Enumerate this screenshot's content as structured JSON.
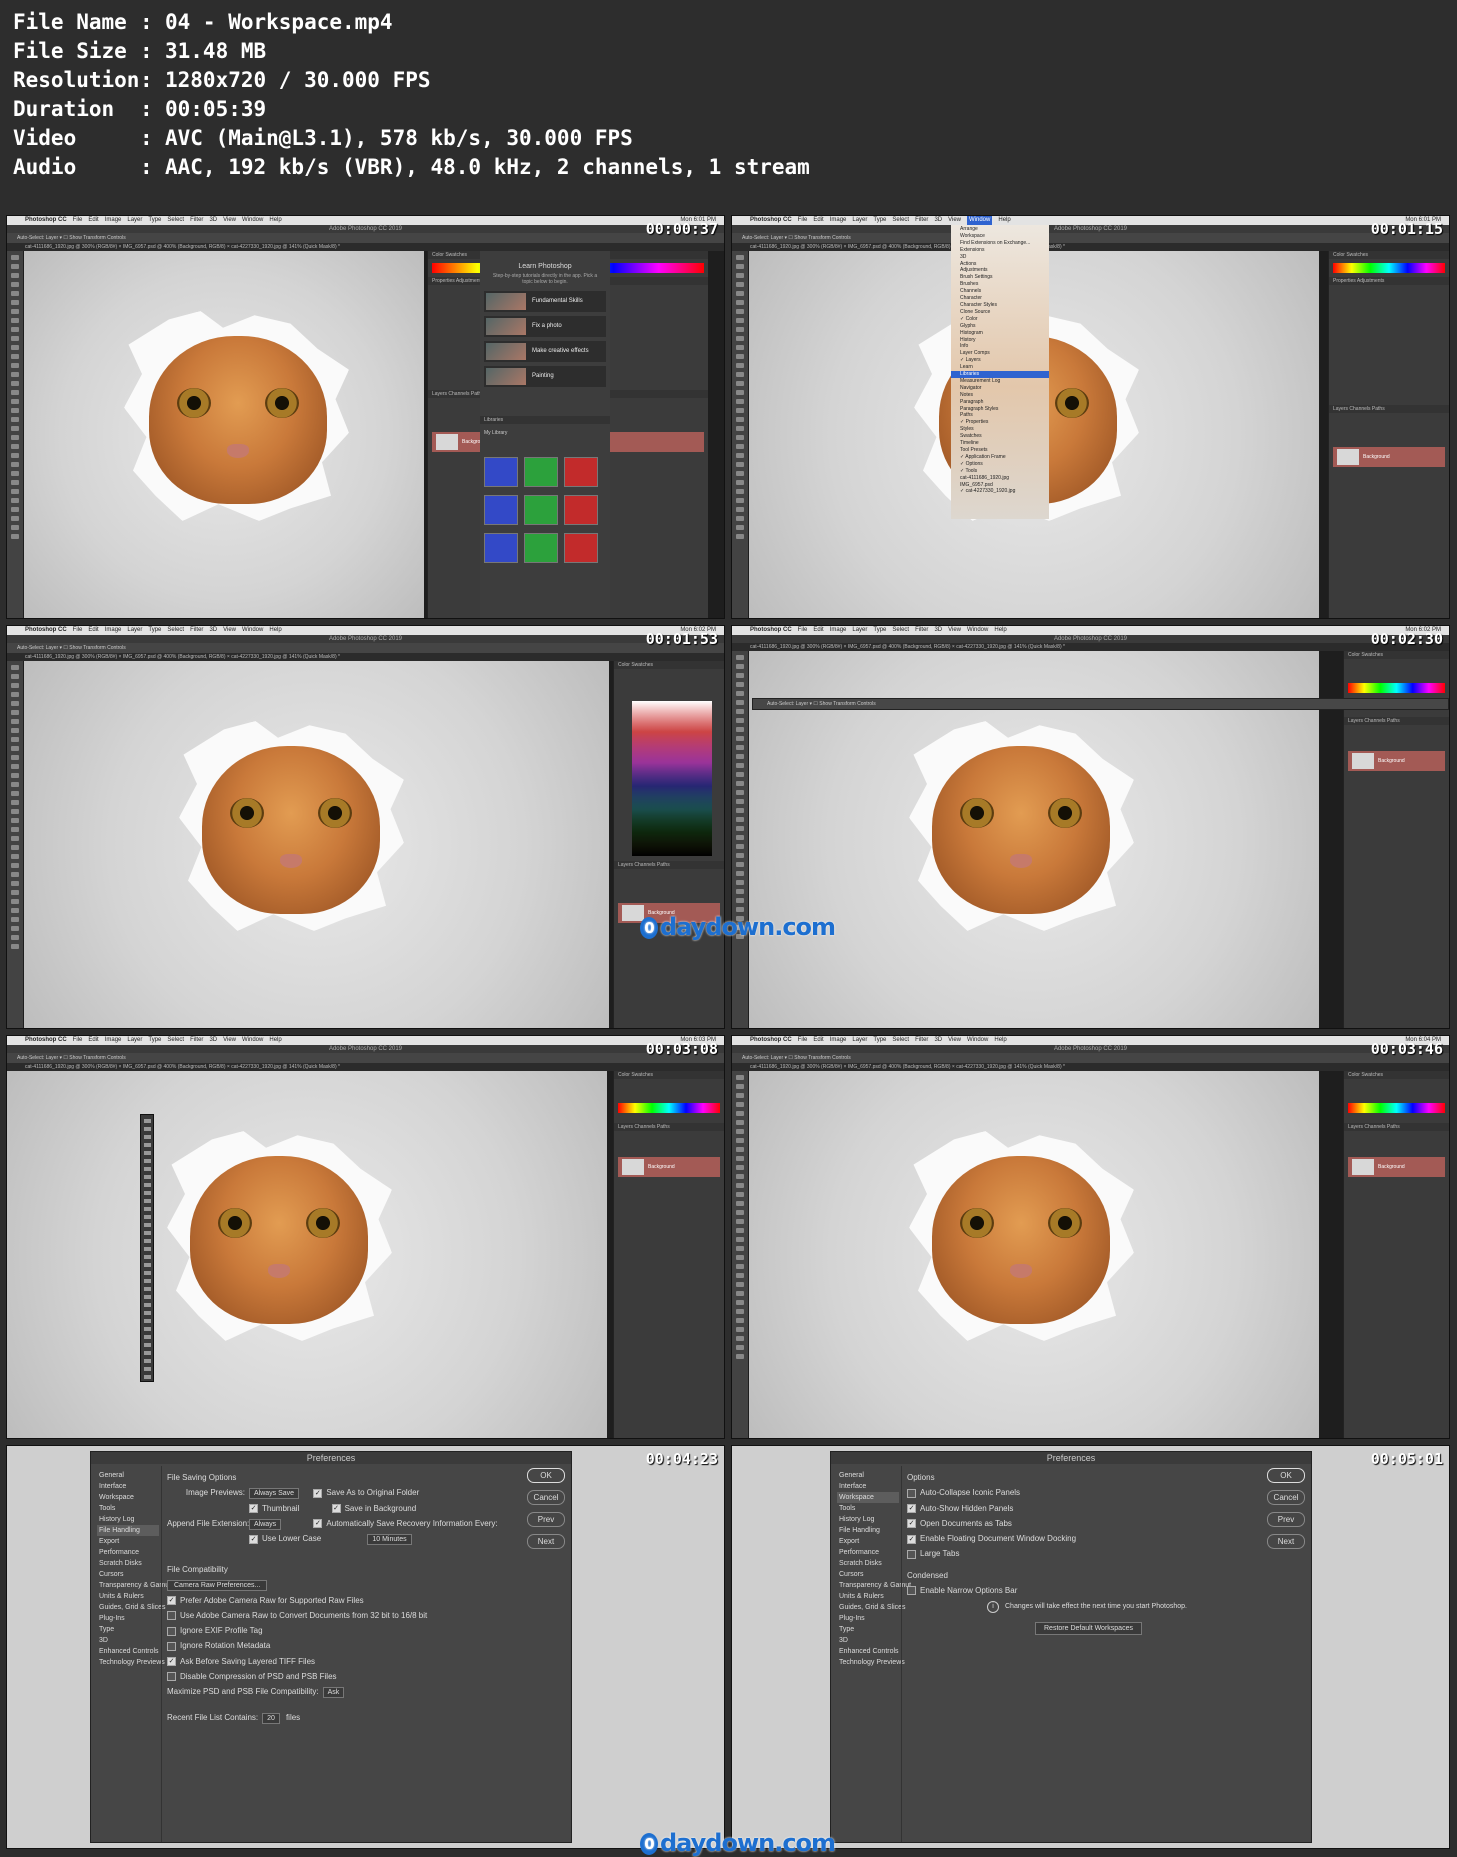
{
  "meta": [
    {
      "key": "File Name",
      "value": "04 - Workspace.mp4"
    },
    {
      "key": "File Size",
      "value": "31.48 MB"
    },
    {
      "key": "Resolution",
      "value": "1280x720 / 30.000 FPS"
    },
    {
      "key": "Duration",
      "value": "00:05:39"
    },
    {
      "key": "Video",
      "value": "AVC (Main@L3.1), 578 kb/s, 30.000 FPS"
    },
    {
      "key": "Audio",
      "value": "AAC, 192 kb/s (VBR), 48.0 kHz, 2 channels, 1 stream"
    }
  ],
  "colon": ":",
  "ps": {
    "app": "Photoshop CC",
    "menus": [
      "File",
      "Edit",
      "Image",
      "Layer",
      "Type",
      "Select",
      "Filter",
      "3D",
      "View",
      "Window",
      "Help"
    ],
    "title": "Adobe Photoshop CC 2019",
    "clock1": "Mon 6:01 PM",
    "clock2": "Mon 6:02 PM",
    "clock3": "Mon 6:03 PM",
    "clock4": "Mon 6:04 PM",
    "options": "Auto-Select:  Layer  ▾   ☐ Show Transform Controls",
    "tabs": "cat-4111686_1920.jpg @ 300% (RGB/8#)   ×   IMG_6957.psd @ 400% (Background, RGB/8)   ×   cat-4227330_1920.jpg @ 141% (Quick Mask/8) *",
    "color_tab": "Color   Swatches",
    "props_tab": "Properties   Adjustments",
    "layers_tab": "Layers   Channels   Paths",
    "layer_name": "Background",
    "libraries": "Libraries",
    "my_library": "My Library"
  },
  "timestamps": [
    "00:00:37",
    "00:01:15",
    "00:01:53",
    "00:02:30",
    "00:03:08",
    "00:03:46",
    "00:04:23",
    "00:05:01"
  ],
  "learn": {
    "title": "Learn Photoshop",
    "subtitle": "Step-by-step tutorials directly in the app. Pick a topic below to begin.",
    "items": [
      "Fundamental Skills",
      "Fix a photo",
      "Make creative effects",
      "Painting"
    ]
  },
  "window_menu": {
    "items": [
      "Arrange",
      "Workspace",
      "",
      "Find Extensions on Exchange...",
      "Extensions",
      "",
      "3D",
      "Actions",
      "Adjustments",
      "Brush Settings",
      "Brushes",
      "Channels",
      "Character",
      "Character Styles",
      "Clone Source",
      "✓ Color",
      "Glyphs",
      "Histogram",
      "History",
      "Info",
      "Layer Comps",
      "✓ Layers",
      "Learn",
      "Libraries",
      "Measurement Log",
      "Navigator",
      "Notes",
      "Paragraph",
      "Paragraph Styles",
      "Paths",
      "✓ Properties",
      "Styles",
      "Swatches",
      "Timeline",
      "Tool Presets",
      "",
      "✓ Application Frame",
      "✓ Options",
      "✓ Tools",
      "",
      "cat-4111686_1920.jpg",
      "IMG_6957.psd",
      "✓ cat-4227330_1920.jpg"
    ],
    "highlighted": "Libraries"
  },
  "prefs": {
    "title": "Preferences",
    "sidebar": [
      "General",
      "Interface",
      "Workspace",
      "Tools",
      "History Log",
      "File Handling",
      "Export",
      "Performance",
      "Scratch Disks",
      "Cursors",
      "Transparency & Gamut",
      "Units & Rulers",
      "Guides, Grid & Slices",
      "Plug-Ins",
      "Type",
      "3D",
      "Enhanced Controls",
      "Technology Previews"
    ],
    "buttons": [
      "OK",
      "Cancel",
      "Prev",
      "Next"
    ],
    "file_handling": {
      "section1": "File Saving Options",
      "image_previews_label": "Image Previews:",
      "image_previews_value": "Always Save",
      "thumbnail": "Thumbnail",
      "append_ext_label": "Append File Extension:",
      "append_ext_value": "Always",
      "lower_case": "Use Lower Case",
      "save_as_original": "Save As to Original Folder",
      "save_background": "Save in Background",
      "auto_save": "Automatically Save Recovery Information Every:",
      "auto_save_value": "10 Minutes",
      "section2": "File Compatibility",
      "camera_raw_btn": "Camera Raw Preferences...",
      "checks": [
        {
          "label": "Prefer Adobe Camera Raw for Supported Raw Files",
          "on": true
        },
        {
          "label": "Use Adobe Camera Raw to Convert Documents from 32 bit to 16/8 bit",
          "on": false
        },
        {
          "label": "Ignore EXIF Profile Tag",
          "on": false
        },
        {
          "label": "Ignore Rotation Metadata",
          "on": false
        },
        {
          "label": "Ask Before Saving Layered TIFF Files",
          "on": true
        },
        {
          "label": "Disable Compression of PSD and PSB Files",
          "on": false
        }
      ],
      "maximize_label": "Maximize PSD and PSB File Compatibility:",
      "maximize_value": "Ask",
      "recent_label": "Recent File List Contains:",
      "recent_value": "20",
      "recent_unit": "files"
    },
    "workspace": {
      "section1": "Options",
      "checks": [
        {
          "label": "Auto-Collapse Iconic Panels",
          "on": false
        },
        {
          "label": "Auto-Show Hidden Panels",
          "on": true
        },
        {
          "label": "Open Documents as Tabs",
          "on": true
        },
        {
          "label": "Enable Floating Document Window Docking",
          "on": true
        },
        {
          "label": "Large Tabs",
          "on": false
        }
      ],
      "section2": "Condensed",
      "narrow": "Enable Narrow Options Bar",
      "note": "Changes will take effect the next time you start Photoshop.",
      "restore_btn": "Restore Default Workspaces"
    }
  },
  "watermark": "daydown.com",
  "watermark_mark": "0"
}
